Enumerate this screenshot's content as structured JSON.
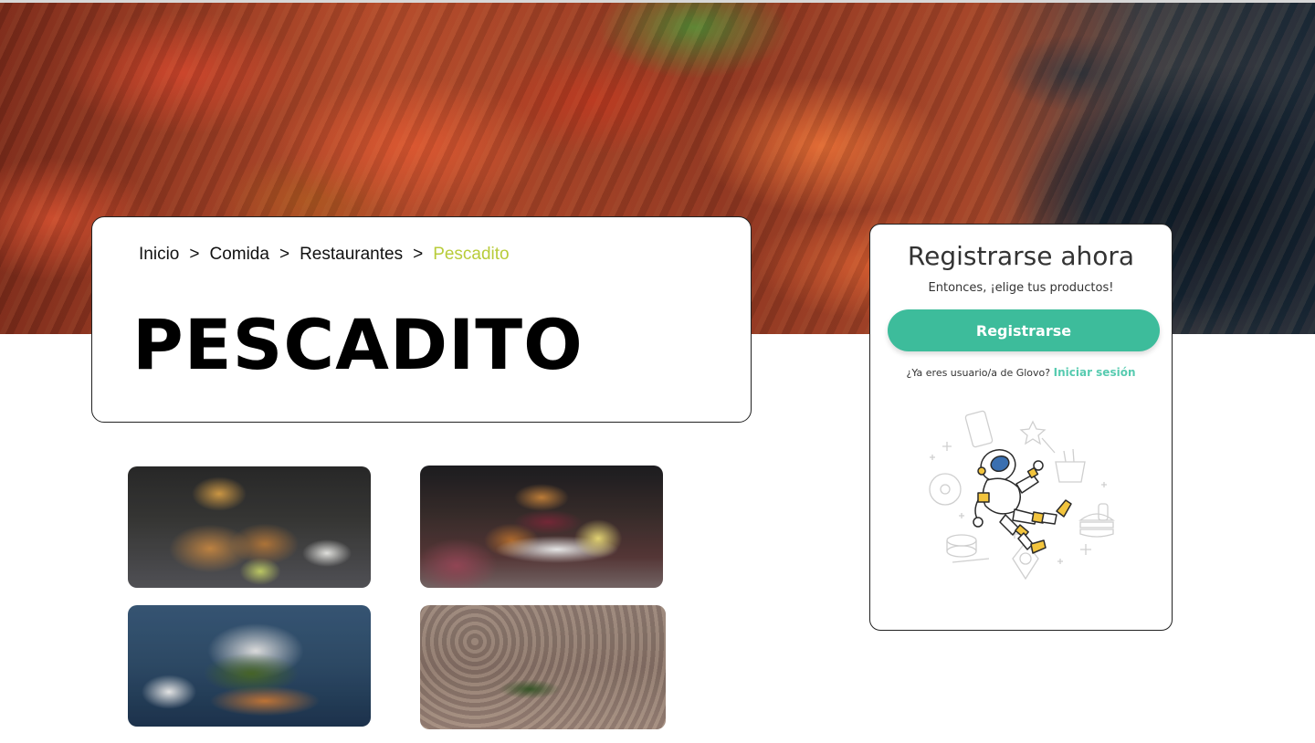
{
  "breadcrumb": {
    "items": [
      "Inicio",
      "Comida",
      "Restaurantes"
    ],
    "current": "Pescadito",
    "separator": ">"
  },
  "page_title": "PESCADITO",
  "register": {
    "title": "Registrarse ahora",
    "subtitle": "Entonces, ¡elige tus productos!",
    "button_label": "Registrarse",
    "login_prompt": "¿Ya eres usuario/a de Glovo?",
    "login_link": "Iniciar sesión"
  },
  "photos": [
    {
      "description_icon": "fish-and-chips-photo"
    },
    {
      "description_icon": "burger-plate-photo"
    },
    {
      "description_icon": "fish-sandwich-photo"
    },
    {
      "description_icon": "seafood-paella-photo"
    }
  ],
  "colors": {
    "accent": "#3dbc9b",
    "link": "#57cbb0",
    "breadcrumb_current": "#b8cc3a"
  }
}
